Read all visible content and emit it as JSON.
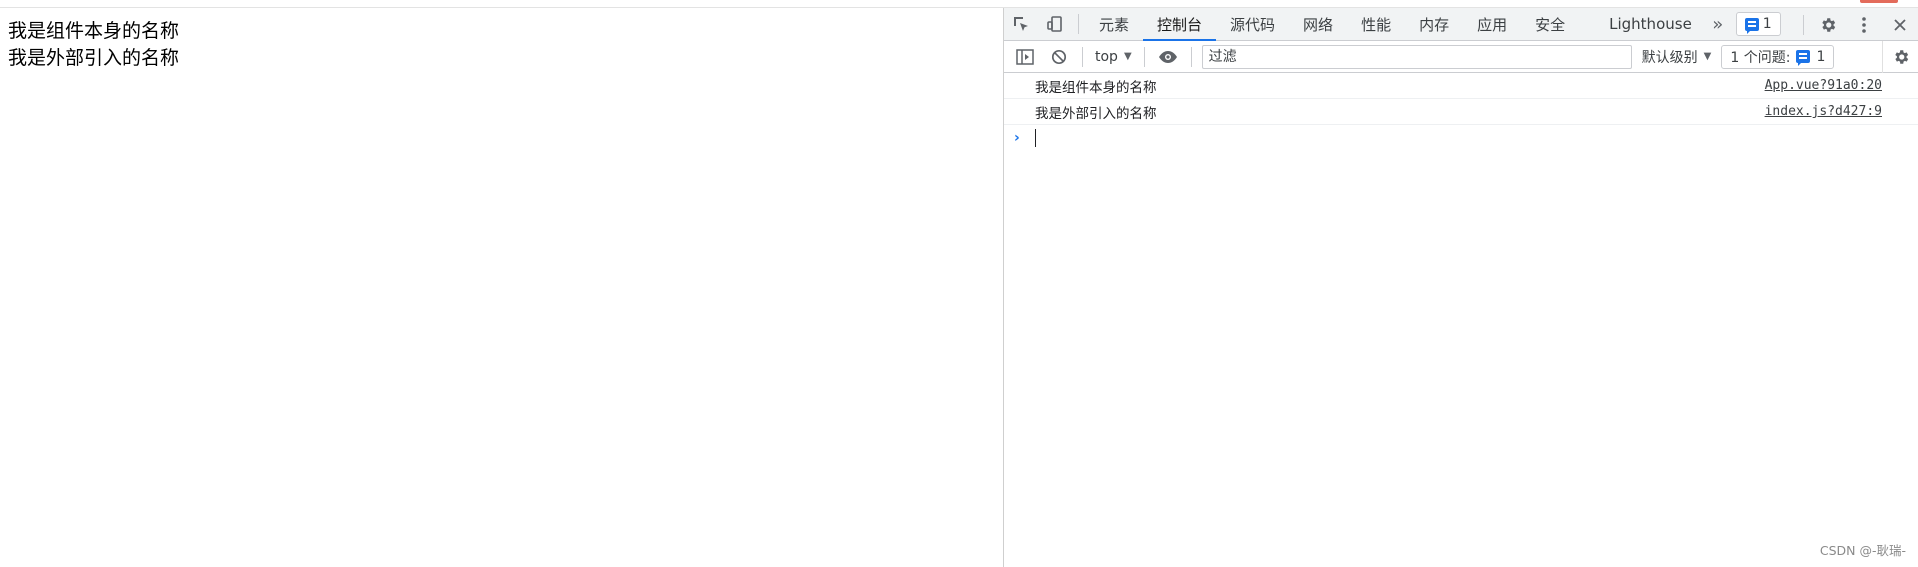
{
  "page": {
    "lines": [
      "我是组件本身的名称",
      "我是外部引入的名称"
    ]
  },
  "devtools": {
    "tabs": [
      {
        "label": "元素",
        "active": false
      },
      {
        "label": "控制台",
        "active": true
      },
      {
        "label": "源代码",
        "active": false
      },
      {
        "label": "网络",
        "active": false
      },
      {
        "label": "性能",
        "active": false
      },
      {
        "label": "内存",
        "active": false
      },
      {
        "label": "应用",
        "active": false
      },
      {
        "label": "安全",
        "active": false
      },
      {
        "label": "Lighthouse",
        "active": false
      }
    ],
    "issue_badge_count": "1",
    "icons": {
      "inspect": "inspect-element-icon",
      "device": "device-toolbar-icon",
      "more_tabs": "double-chevron-right-icon",
      "settings": "gear-icon",
      "menu": "kebab-menu-icon",
      "close": "close-icon"
    },
    "toolbar": {
      "context": "top",
      "filter_placeholder": "过滤",
      "levels_label": "默认级别",
      "issues_label": "1 个问题:",
      "issues_count": "1"
    },
    "console": {
      "messages": [
        {
          "text": "我是组件本身的名称",
          "source": "App.vue?91a0:20"
        },
        {
          "text": "我是外部引入的名称",
          "source": "index.js?d427:9"
        }
      ]
    },
    "accent_color": "#1a73e8"
  },
  "watermark": "CSDN @-耿瑞-"
}
